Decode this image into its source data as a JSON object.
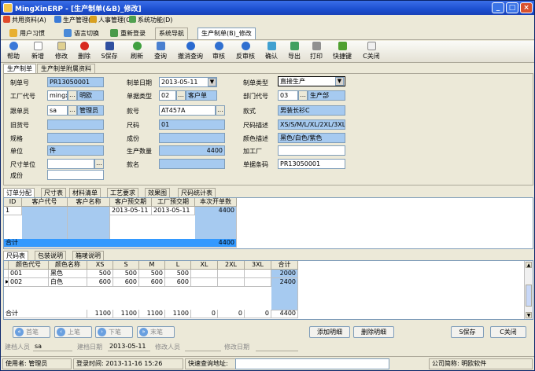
{
  "title": "MingXinERP - [生产制单(&B)_修改]",
  "menus": [
    "共用资料(A)",
    "生产管理(B)",
    "人事管理(C)",
    "系统功能(D)"
  ],
  "top_tabs": {
    "user_pref": "用户习惯",
    "lang": "语言切换",
    "relogin": "重新登录",
    "nav": "系统导航",
    "current": "生产制单(B)_修改"
  },
  "toolbar": [
    "帮助",
    "新增",
    "修改",
    "删除",
    "S保存",
    "刷新",
    "查询",
    "撤消查询",
    "审核",
    "反审核",
    "确认",
    "导出",
    "打印",
    "快捷键",
    "C关闭"
  ],
  "subtabs": [
    "生产制单",
    "生产制单附属资料"
  ],
  "form": {
    "order_no_label": "制单号",
    "order_no": "PR13050001",
    "factory_code_label": "工厂代号",
    "factory_code": "mingxin",
    "factory_name": "明欧",
    "follower_label": "跟单员",
    "follower_code": "sa",
    "follower_name": "管理员",
    "old_no_label": "旧货号",
    "old_no": "",
    "spec_label": "规格",
    "spec": "",
    "unit_label": "单位",
    "unit": "件",
    "size_unit_label": "尺寸单位",
    "size_unit": "",
    "composition_label": "成份",
    "composition": "",
    "date_label": "制单日期",
    "date": "2013-05-11",
    "doc_type_label": "单据类型",
    "doc_type_code": "02",
    "doc_type_name": "客户单",
    "style_no_label": "款号",
    "style_no": "AT457A",
    "size_label": "尺码",
    "size": "01",
    "material_label": "成份",
    "material": "",
    "qty_label": "生产数量",
    "qty": "4400",
    "style_name_label": "款名",
    "style_name": "",
    "order_type_label": "制单类型",
    "order_type": "直接生产",
    "dept_label": "部门代号",
    "dept_code": "03",
    "dept_name": "生产部",
    "style_label": "款式",
    "style": "男装长衫C",
    "size_desc_label": "尺码描述",
    "size_desc": "XS/S/M/L/XL/2XL/3XL",
    "color_desc_label": "颜色描述",
    "color_desc": "黑色/白色/紫色",
    "proc_factory_label": "加工厂",
    "proc_factory": "",
    "barcode_label": "单据条码",
    "barcode": "PR13050001"
  },
  "grid1_tabs": [
    "订单分配",
    "尺寸表",
    "材料清单",
    "工艺要求",
    "效果图",
    "尺码统计表"
  ],
  "grid1": {
    "headers": [
      "ID",
      "客户代号",
      "客户名称",
      "客户预交期",
      "工厂预交期",
      "本次开单数"
    ],
    "rows": [
      [
        "1",
        "",
        "",
        "2013-05-11",
        "2013-05-11",
        "4400"
      ]
    ],
    "total_label": "合计",
    "total": "4400"
  },
  "grid2_tabs": [
    "尺码表",
    "包装说明",
    "箱唛说明"
  ],
  "grid2": {
    "headers": [
      "颜色代号",
      "颜色名称",
      "XS",
      "S",
      "M",
      "L",
      "XL",
      "2XL",
      "3XL",
      "合计"
    ],
    "rows": [
      [
        "001",
        "黑色",
        "500",
        "500",
        "500",
        "500",
        "",
        "",
        "",
        "2000"
      ],
      [
        "002",
        "白色",
        "600",
        "600",
        "600",
        "600",
        "",
        "",
        "",
        "2400"
      ]
    ],
    "total_label": "合计",
    "totals": [
      "",
      "1100",
      "1100",
      "1100",
      "1100",
      "0",
      "0",
      "0",
      "4400"
    ]
  },
  "nav_buttons": [
    "首笔",
    "上笔",
    "下笔",
    "末笔"
  ],
  "action_buttons": [
    "添加明细",
    "删除明细",
    "S保存",
    "C关闭"
  ],
  "audit": {
    "creator_label": "建档人员",
    "creator": "sa",
    "create_date_label": "建档日期",
    "create_date": "2013-05-11",
    "modifier_label": "修改人员",
    "modifier": "",
    "modify_date_label": "修改日期",
    "modify_date": ""
  },
  "status": {
    "user": "使用者: 管理员",
    "login_time": "登录时间: 2013-11-16 15:26",
    "quick_query": "快速查询地址:",
    "company": "公司简称: 明欧软件"
  },
  "colors": {
    "title_blue": "#1c4fd0",
    "field_blue": "#a6caf0",
    "selected_row": "#3399ff"
  }
}
